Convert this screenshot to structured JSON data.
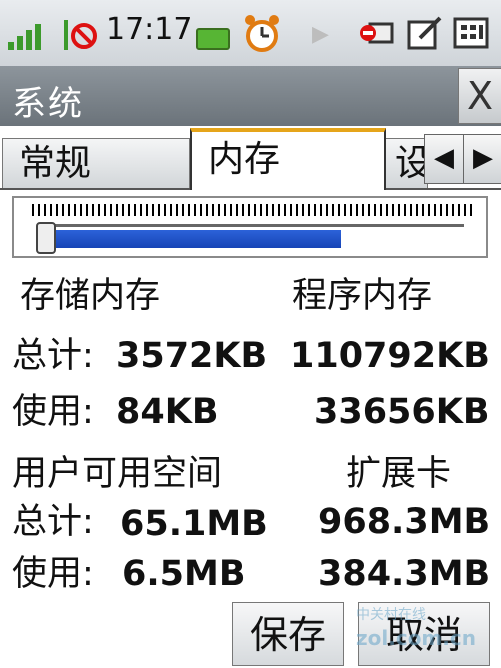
{
  "status_bar": {
    "time": "17:17"
  },
  "window": {
    "title": "系统",
    "close_label": "X"
  },
  "tabs": [
    {
      "label": "常规",
      "active": false
    },
    {
      "label": "内存",
      "active": true
    },
    {
      "label": "设",
      "active": false
    }
  ],
  "nav": {
    "prev_label": "◀",
    "next_label": "▶"
  },
  "slider": {
    "fill_fraction": 0.7
  },
  "storage": {
    "header": "存储内存",
    "total_label": "总计:",
    "total_value": "3572KB",
    "used_label": "使用:",
    "used_value": "84KB"
  },
  "program": {
    "header": "程序内存",
    "total_value": "110792KB",
    "used_value": "33656KB"
  },
  "user_space": {
    "header": "用户可用空间",
    "total_label": "总计:",
    "total_value": "65.1MB",
    "used_label": "使用:",
    "used_value": "6.5MB"
  },
  "card": {
    "header": "扩展卡",
    "total_value": "968.3MB",
    "used_value": "384.3MB"
  },
  "buttons": {
    "save": "保存",
    "cancel": "取消"
  },
  "watermark": {
    "text": "中关村在线",
    "subtext": "zol.com.cn"
  }
}
